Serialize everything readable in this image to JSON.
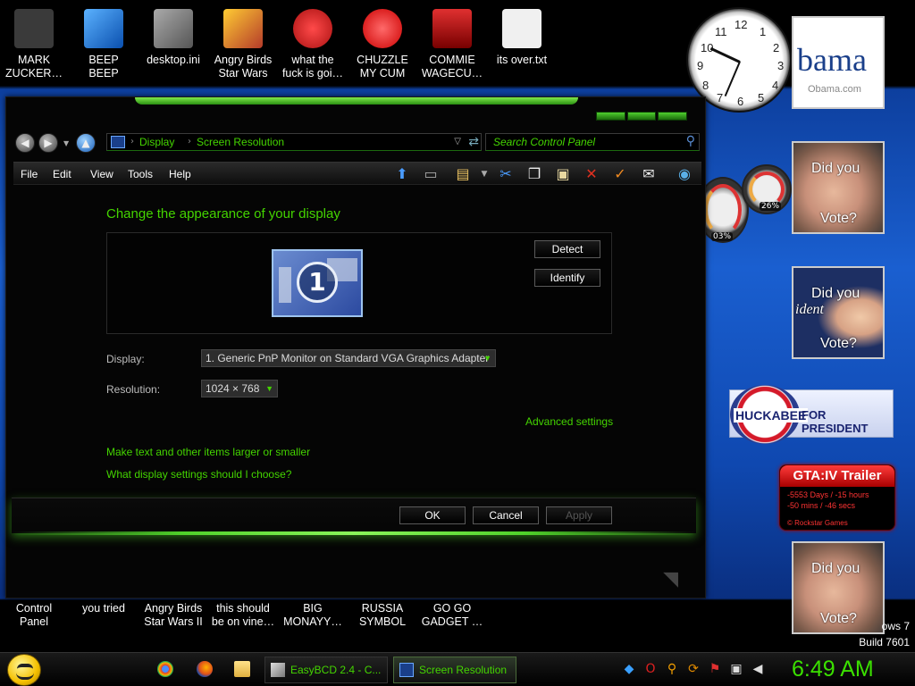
{
  "desktop_icons_top": [
    {
      "label": "MARK\nZUCKER…",
      "color": "#4a4a4a"
    },
    {
      "label": "BEEP\nBEEP",
      "color": "#1f78d6"
    },
    {
      "label": "desktop.ini",
      "color": "#7a7a7a"
    },
    {
      "label": "Angry Birds\nStar Wars",
      "color": "#b43b2a"
    },
    {
      "label": "what the\nfuck is goi…",
      "color": "#d93030"
    },
    {
      "label": "CHUZZLE\nMY CUM",
      "color": "#e02a2a"
    },
    {
      "label": "COMMIE\nWAGECU…",
      "color": "#c42020"
    },
    {
      "label": "its over.txt",
      "color": "#dcdcdc"
    }
  ],
  "desktop_icons_bottom": [
    {
      "label": "Control\nPanel"
    },
    {
      "label": "you tried"
    },
    {
      "label": "Angry Birds\nStar Wars II"
    },
    {
      "label": "this should\nbe on vine…"
    },
    {
      "label": "BIG\nMONAYY…"
    },
    {
      "label": "RUSSIA\nSYMBOL"
    },
    {
      "label": "GO GO\nGADGET …"
    }
  ],
  "window": {
    "breadcrumb": [
      "Display",
      "Screen Resolution"
    ],
    "search_placeholder": "Search Control Panel",
    "menu": [
      "File",
      "Edit",
      "View",
      "Tools",
      "Help"
    ],
    "title": "Change the appearance of your display",
    "monitor_number": "1",
    "detect_label": "Detect",
    "identify_label": "Identify",
    "display_label": "Display:",
    "display_value": "1. Generic PnP Monitor on Standard VGA Graphics Adapter",
    "resolution_label": "Resolution:",
    "resolution_value": "1024 × 768",
    "advanced_link": "Advanced settings",
    "link_text_size": "Make text and other items larger or smaller",
    "link_choose": "What display settings should I choose?",
    "ok_label": "OK",
    "cancel_label": "Cancel",
    "apply_label": "Apply"
  },
  "gadgets": {
    "clock_numbers": [
      "12",
      "1",
      "2",
      "3",
      "4",
      "5",
      "6",
      "7",
      "8",
      "9",
      "10",
      "11"
    ],
    "obama_logo": "bama",
    "obama_url": "Obama.com",
    "vote_top": "Did you",
    "vote_bottom": "Vote?",
    "hillary_overlay": "ident",
    "meter_left": "03%",
    "meter_right": "26%",
    "huckabee_name": "HUCKABEE",
    "huckabee_for": "FOR PRESIDENT",
    "gta_title": "GTA:IV Trailer",
    "gta_line1": "-5553 Days / -15 hours",
    "gta_line2": "-50 mins / -46 secs",
    "gta_line3": "© Rockstar Games",
    "build_partial": "ows 7",
    "build_number": "Build 7601"
  },
  "taskbar": {
    "tasks": [
      {
        "label": "EasyBCD 2.4 - C...",
        "active": false
      },
      {
        "label": "Screen Resolution",
        "active": true
      }
    ],
    "time": "6:49 AM"
  }
}
